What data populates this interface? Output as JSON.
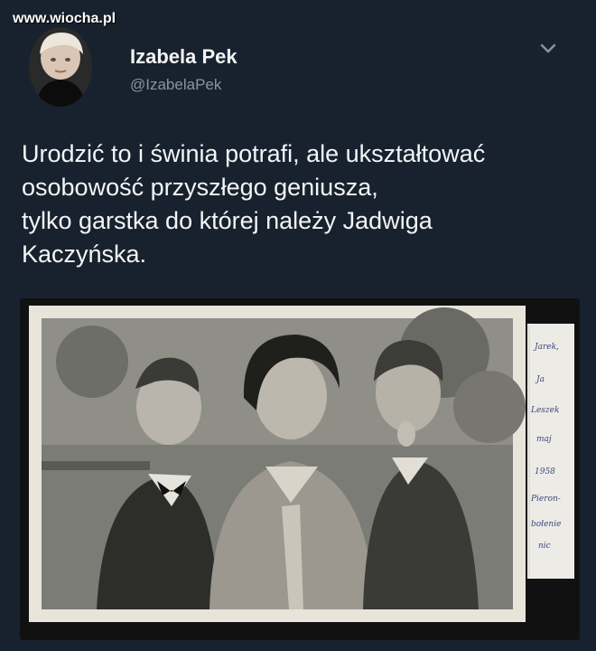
{
  "watermark": "www.wiocha.pl",
  "tweet": {
    "author_name": "Izabela Pek",
    "author_handle": "@IzabelaPek",
    "text_lines": [
      "Urodzić to i świnia potrafi, ale ukształtować",
      "osobowość przyszłego geniusza,",
      "tylko garstka do której należy Jadwiga",
      "Kaczyńska."
    ]
  },
  "photo_note": {
    "lines": [
      "Jarek,",
      "Ja",
      "Leszek",
      "maj",
      "1958",
      "Pieron-",
      "bołenie",
      "nic"
    ]
  },
  "icons": {
    "menu": "chevron-down-icon"
  }
}
